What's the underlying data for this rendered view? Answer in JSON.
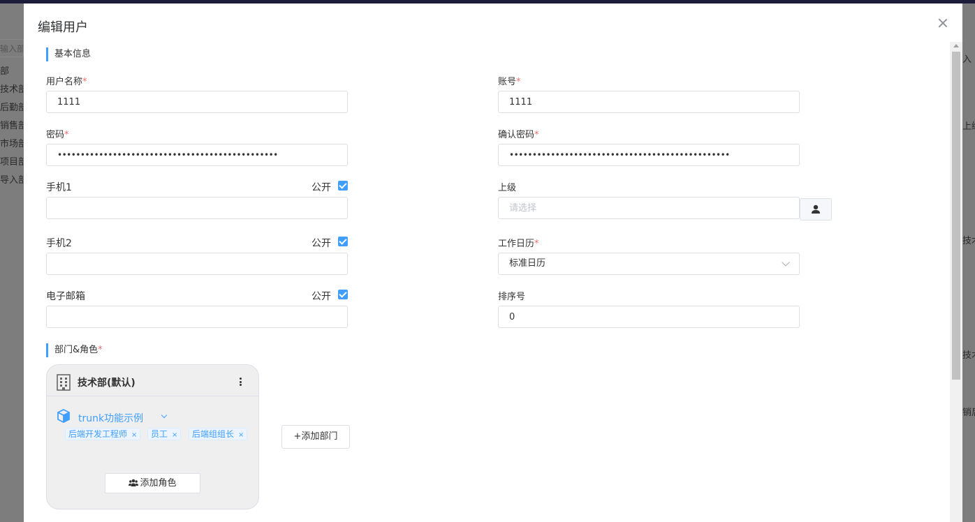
{
  "background": {
    "left_panel": {
      "search_placeholder": "输入部门",
      "nodes": [
        "部",
        "技术部",
        "后勤部",
        "销售部",
        "市场部",
        "项目部",
        "导入部"
      ]
    },
    "right_panel": {
      "fragments": [
        "入",
        "上级",
        "技术",
        "技术",
        "销后"
      ]
    }
  },
  "modal": {
    "title": "编辑用户",
    "basic_section": "基本信息",
    "fields": {
      "username": {
        "label": "用户名称",
        "value": "1111"
      },
      "account": {
        "label": "账号",
        "value": "1111"
      },
      "password": {
        "label": "密码",
        "value": "••••••••••••••••••••••••••••••••••••••••••••••••"
      },
      "confirm_password": {
        "label": "确认密码",
        "value": "••••••••••••••••••••••••••••••••••••••••••••••••"
      },
      "phone1": {
        "label": "手机1",
        "value": "",
        "public_label": "公开",
        "public_checked": true
      },
      "superior": {
        "label": "上级",
        "placeholder": "请选择"
      },
      "phone2": {
        "label": "手机2",
        "value": "",
        "public_label": "公开",
        "public_checked": true
      },
      "work_calendar": {
        "label": "工作日历",
        "value": "标准日历"
      },
      "email": {
        "label": "电子邮箱",
        "value": "",
        "public_label": "公开",
        "public_checked": true
      },
      "sort_no": {
        "label": "排序号",
        "value": "0"
      }
    },
    "dept_section": "部门&角色",
    "dept_card": {
      "name": "技术部(默认)",
      "role_group": "trunk功能示例",
      "roles": [
        "后端开发工程师",
        "员工",
        "后端组组长"
      ],
      "add_role_label": "添加角色"
    },
    "add_dept_label": "+添加部门",
    "accent_color": "#409eff",
    "required_color": "#f56c6c"
  }
}
